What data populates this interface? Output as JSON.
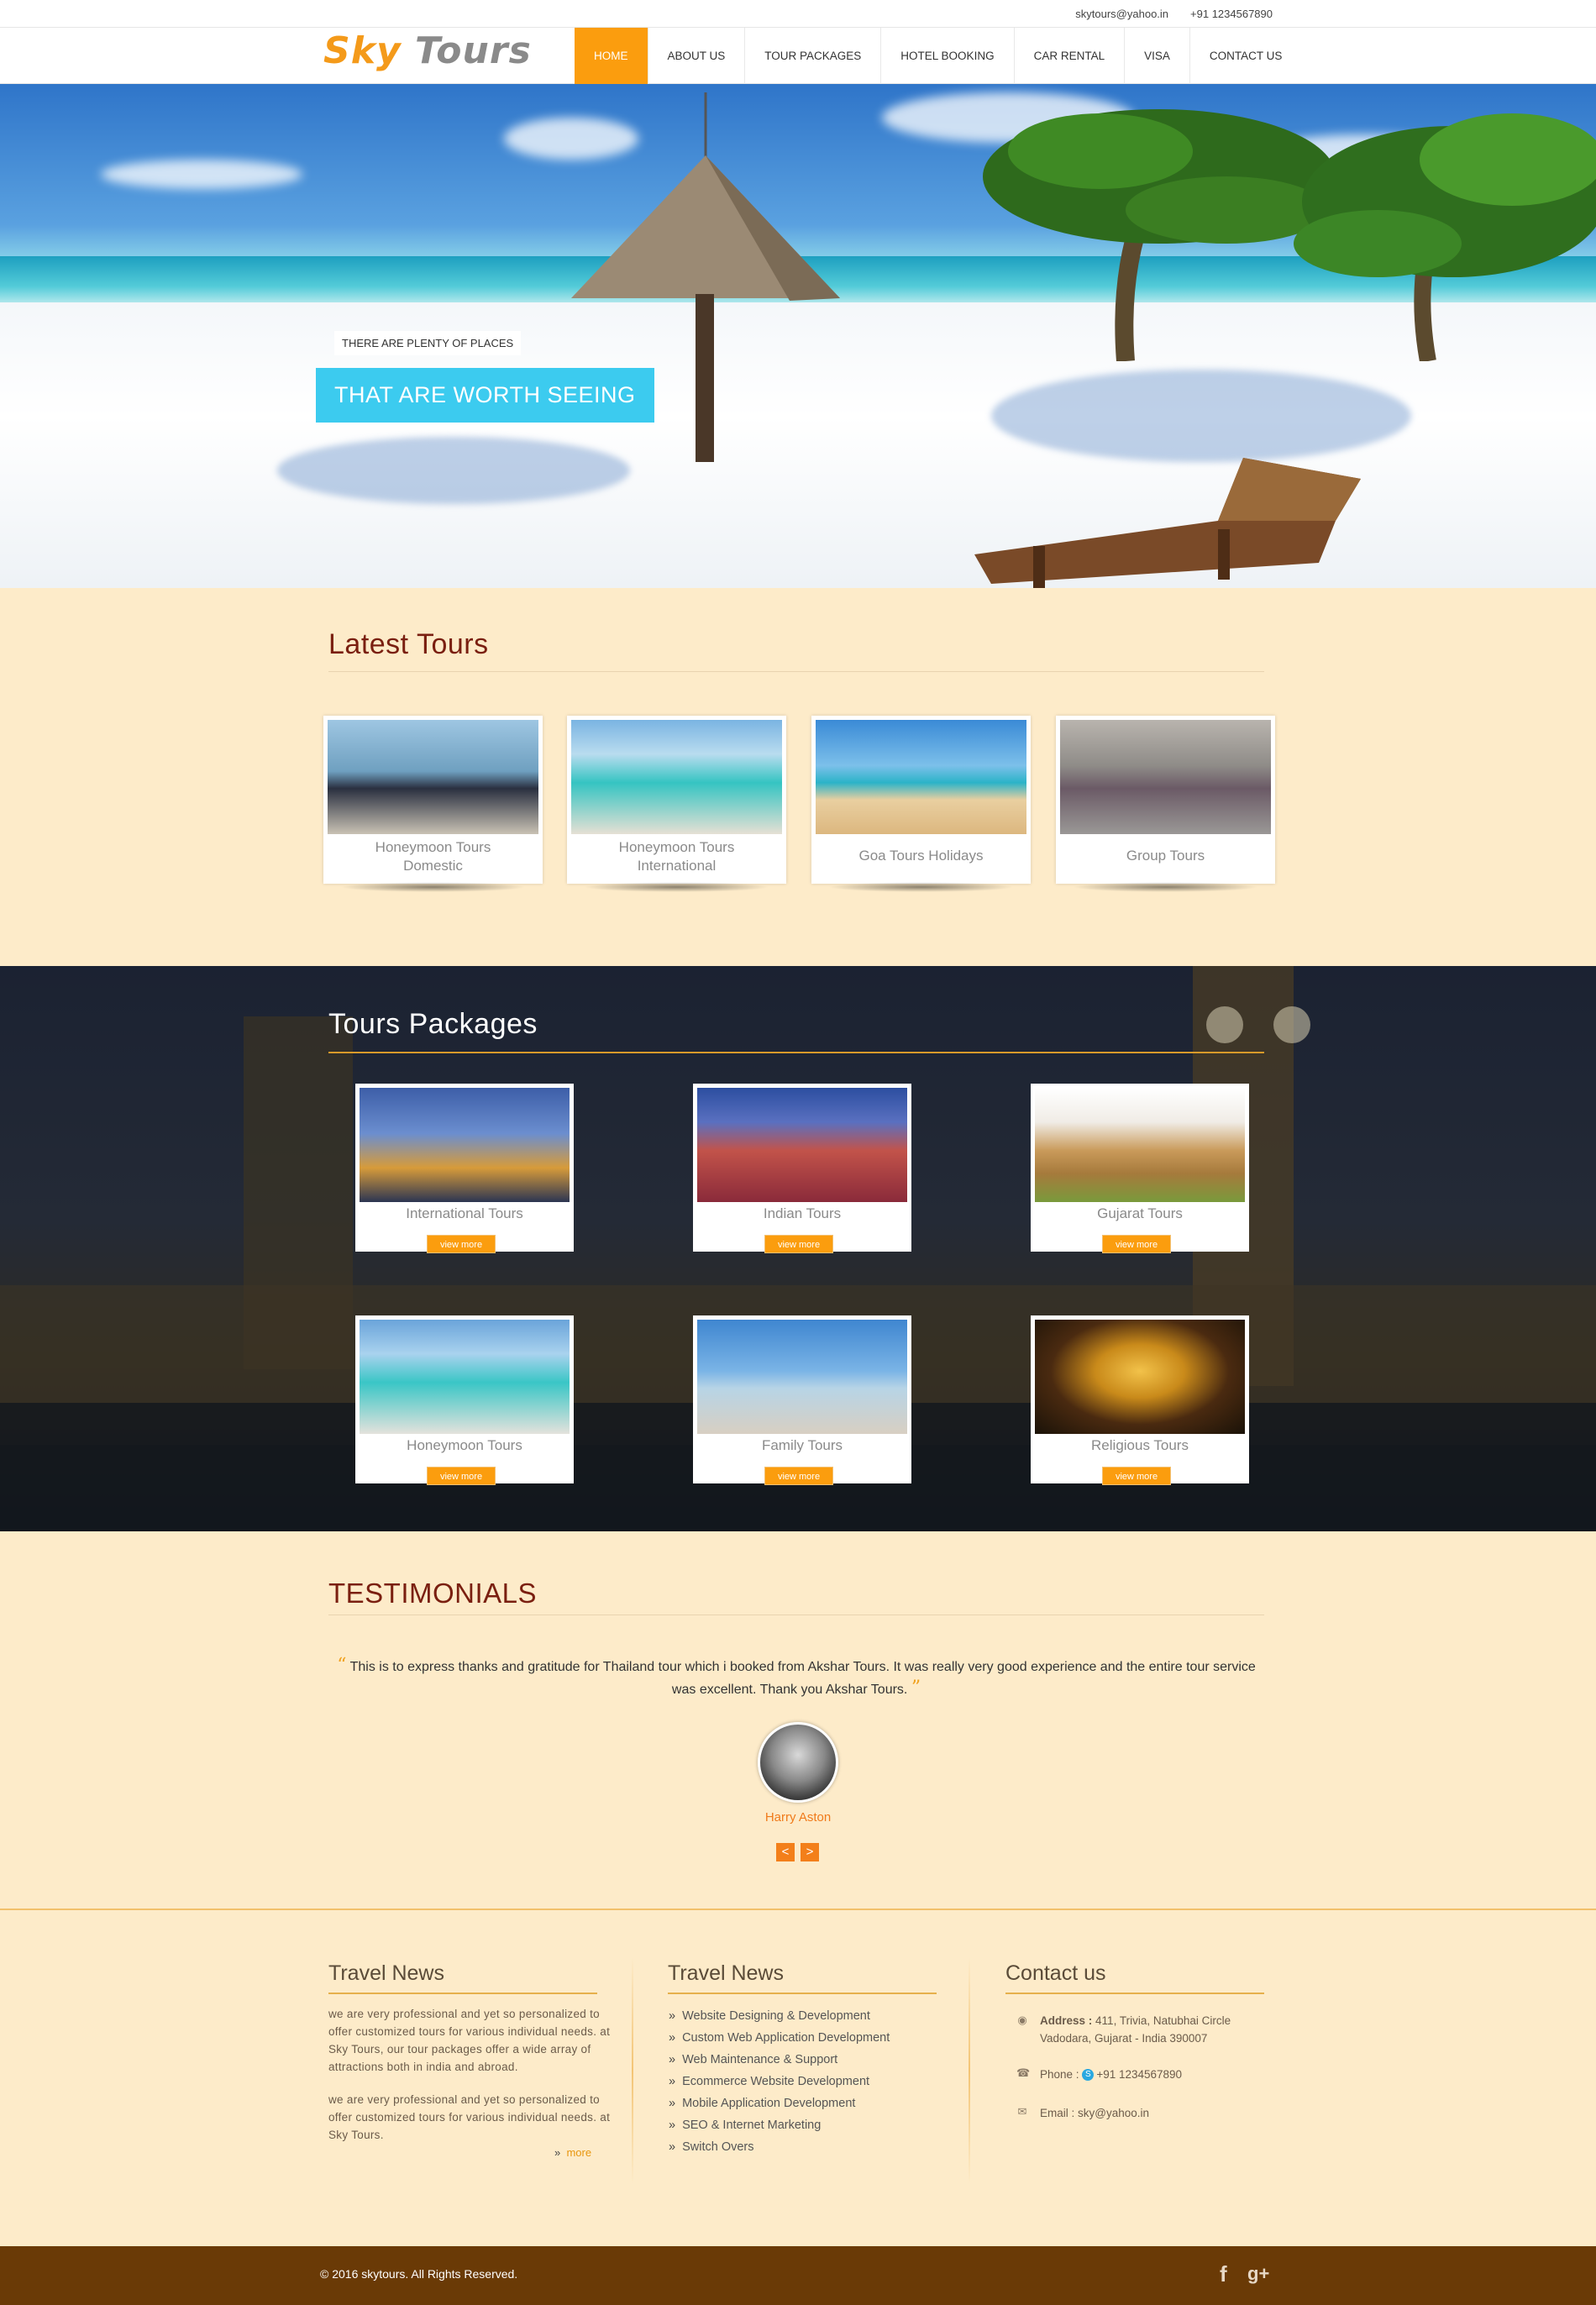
{
  "topbar": {
    "email": "skytours@yahoo.in",
    "phone": "+91 1234567890"
  },
  "logo": {
    "part1": "Sky",
    "part2": "Tours"
  },
  "nav": [
    "HOME",
    "ABOUT US",
    "TOUR PACKAGES",
    "HOTEL BOOKING",
    "CAR RENTAL",
    "VISA",
    "CONTACT US"
  ],
  "hero": {
    "tagline": "THERE ARE PLENTY OF PLACES",
    "headline": "THAT ARE WORTH SEEING"
  },
  "latest": {
    "title": "Latest Tours",
    "cards": [
      {
        "line1": "Honeymoon Tours",
        "line2": "Domestic",
        "image_icon": "couple-dinner-photo"
      },
      {
        "line1": "Honeymoon Tours",
        "line2": "International",
        "image_icon": "couple-water-villa-photo"
      },
      {
        "line1": "Goa Tours Holidays",
        "line2": "",
        "image_icon": "beach-umbrellas-photo"
      },
      {
        "line1": "Group Tours",
        "line2": "",
        "image_icon": "segway-group-photo"
      }
    ]
  },
  "packages": {
    "title": "Tours Packages",
    "button_label": "view more",
    "cards": [
      {
        "label": "International Tours",
        "image_icon": "london-parliament-photo"
      },
      {
        "label": "Indian Tours",
        "image_icon": "jaipur-palace-photo"
      },
      {
        "label": "Gujarat Tours",
        "image_icon": "vadodara-palace-photo"
      },
      {
        "label": "Honeymoon Tours",
        "image_icon": "couple-beach-photo"
      },
      {
        "label": "Family Tours",
        "image_icon": "family-beach-photo"
      },
      {
        "label": "Religious Tours",
        "image_icon": "golden-pagoda-photo"
      }
    ]
  },
  "testimonials": {
    "title": "TESTIMONIALS",
    "quote": "This is to express thanks and gratitude for Thailand tour which i booked from Akshar Tours. It was really very good experience and the entire tour service was excellent. Thank you Akshar Tours.",
    "name": "Harry Aston",
    "prev": "<",
    "next": ">"
  },
  "footer": {
    "news": {
      "title": "Travel News",
      "para1": "we are very professional and yet so personalized to offer customized tours for various individual needs. at Sky Tours, our tour packages offer a wide array of attractions both in india and abroad.",
      "para2": "we are very professional and yet so personalized to offer customized tours for various individual needs. at Sky Tours.",
      "more": "more"
    },
    "services": {
      "title": "Travel News",
      "items": [
        "Website Designing & Development",
        "Custom Web Application Development",
        "Web Maintenance & Support",
        "Ecommerce Website Development",
        "Mobile Application Development",
        "SEO & Internet Marketing",
        "Switch Overs"
      ]
    },
    "contact": {
      "title": "Contact us",
      "address_label": "Address :",
      "address_line1": "411, Trivia, Natubhai Circle",
      "address_line2": "Vadodara, Gujarat - India 390007",
      "phone_label": "Phone :",
      "phone": "+91 1234567890",
      "email_label": "Email :",
      "email": "sky@yahoo.in"
    }
  },
  "bottom": {
    "copyright": "© 2016 skytours. All Rights Reserved.",
    "facebook": "f",
    "gplus": "g+"
  },
  "colors": {
    "accent": "#fb9d0e",
    "heading_dark_red": "#7a1f10",
    "hero_banner": "#3ccbef",
    "footer_bar": "#6a3a06",
    "section_bg": "#fdebc9"
  }
}
